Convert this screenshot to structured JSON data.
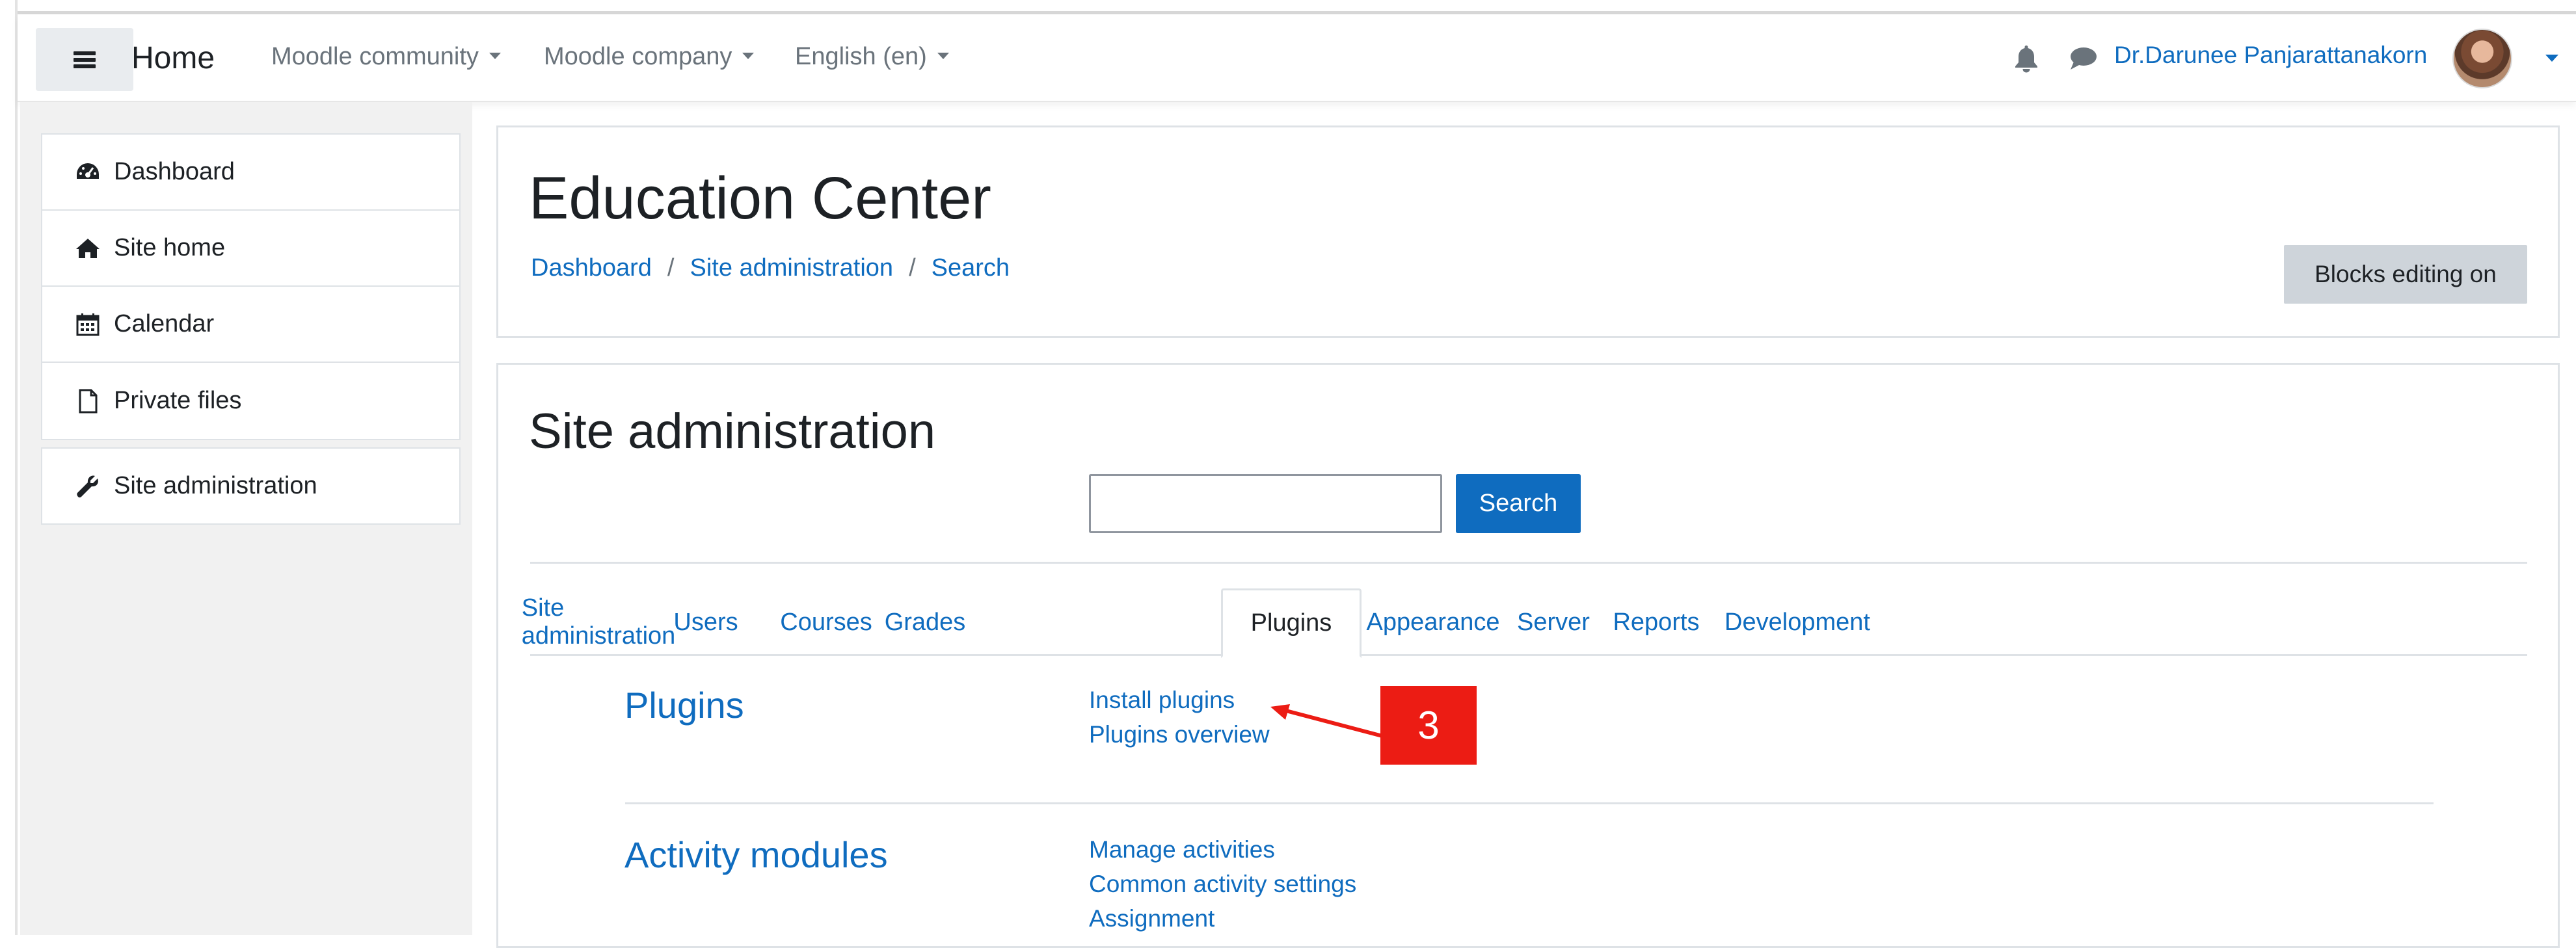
{
  "navbar": {
    "brand": "Home",
    "menus": [
      "Moodle community",
      "Moodle company",
      "English (en)"
    ],
    "user_name": "Dr.Darunee Panjarattanakorn",
    "icons": [
      "hamburger-icon",
      "bell-icon",
      "chat-icon",
      "avatar"
    ]
  },
  "drawer": {
    "items": [
      {
        "label": "Dashboard",
        "icon": "dashboard-icon"
      },
      {
        "label": "Site home",
        "icon": "home-icon"
      },
      {
        "label": "Calendar",
        "icon": "calendar-icon"
      },
      {
        "label": "Private files",
        "icon": "file-icon"
      }
    ],
    "admin_item": {
      "label": "Site administration",
      "icon": "wrench-icon"
    }
  },
  "header": {
    "title": "Education Center",
    "breadcrumb": [
      "Dashboard",
      "Site administration",
      "Search"
    ],
    "blocks_button": "Blocks editing on"
  },
  "admin": {
    "title": "Site administration",
    "search_value": "",
    "search_button": "Search",
    "tabs": [
      "Site administration",
      "Users",
      "Courses",
      "Grades",
      "Plugins",
      "Appearance",
      "Server",
      "Reports",
      "Development"
    ],
    "active_tab": "Plugins",
    "categories": [
      {
        "title": "Plugins",
        "links": [
          "Install plugins",
          "Plugins overview"
        ]
      },
      {
        "title": "Activity modules",
        "links": [
          "Manage activities",
          "Common activity settings",
          "Assignment"
        ]
      }
    ]
  },
  "annotation": {
    "label": "3",
    "color": "#ec1c14"
  },
  "colors": {
    "link": "#0f6cbf",
    "primary": "#0f6cbf",
    "secondary_button": "#ced4da",
    "drawer_bg": "#f1f1f1"
  }
}
